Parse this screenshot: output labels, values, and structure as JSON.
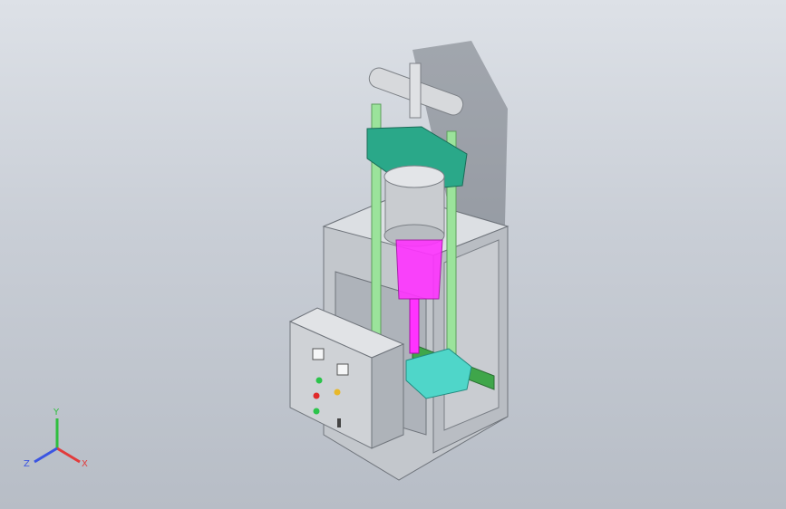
{
  "viewport": {
    "background_top": "#dde1e7",
    "background_bottom": "#b7bdc6"
  },
  "model": {
    "colors": {
      "cabinet": "#d2d5d9",
      "guide_rod": "#9be39b",
      "top_plate": "#2aa889",
      "cylinder": "#c9ccd0",
      "piston_magenta": "#ff33ff",
      "fixture_cyan": "#4fd6c9",
      "rail_green": "#3fa64a",
      "control_box": "#cfd2d6"
    },
    "control_panel": {
      "indicator_colors": [
        "#2bc44b",
        "#e02a2a",
        "#e8b82a",
        "#2bc44b"
      ]
    }
  },
  "triad": {
    "x_label": "X",
    "y_label": "Y",
    "z_label": "Z",
    "x_color": "#e23b3b",
    "y_color": "#2fbf3f",
    "z_color": "#3b55e2"
  }
}
